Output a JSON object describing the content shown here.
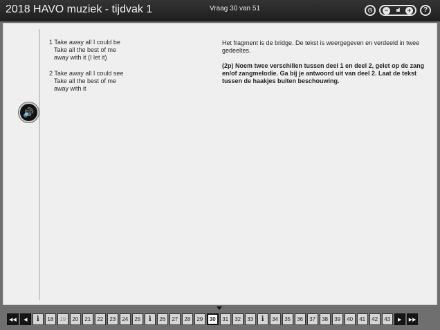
{
  "titlebar": {
    "app_title": "2018 HAVO muziek - tijdvak 1",
    "question_counter": "Vraag 30 van 51",
    "timer_icon": "clock-icon",
    "volume_label": "◂ıııll ▸",
    "help_label": "?"
  },
  "lyrics": {
    "part1": [
      "1 Take away all I could be",
      "Take all the best of me",
      "away with it (I let it)"
    ],
    "part2": [
      "2 Take away all I could see",
      "Take all the best of me",
      "away with it"
    ]
  },
  "question": {
    "intro": "Het fragment is de bridge. De tekst is weergegeven en verdeeld in twee gedeeltes.",
    "text": "(2p) Noem twee verschillen tussen deel 1 en deel 2, gelet op de zang en/of zangmelodie. Ga bij je antwoord uit van deel 2. Laat de tekst tussen de haakjes buiten beschouwing."
  },
  "navigation": {
    "buttons": [
      {
        "label": "◀◀",
        "kind": "dark",
        "name": "first-page-button"
      },
      {
        "label": "◀",
        "kind": "dark",
        "name": "prev-page-button"
      },
      {
        "label": "i",
        "kind": "info",
        "name": "info-button"
      },
      {
        "label": "18",
        "kind": "num"
      },
      {
        "label": "19",
        "kind": "visited"
      },
      {
        "label": "20",
        "kind": "num"
      },
      {
        "label": "21",
        "kind": "num"
      },
      {
        "label": "22",
        "kind": "num"
      },
      {
        "label": "23",
        "kind": "num"
      },
      {
        "label": "24",
        "kind": "num"
      },
      {
        "label": "25",
        "kind": "num"
      },
      {
        "label": "i",
        "kind": "info",
        "name": "info-button"
      },
      {
        "label": "26",
        "kind": "num"
      },
      {
        "label": "27",
        "kind": "num"
      },
      {
        "label": "28",
        "kind": "num"
      },
      {
        "label": "29",
        "kind": "num"
      },
      {
        "label": "30",
        "kind": "current"
      },
      {
        "label": "31",
        "kind": "num"
      },
      {
        "label": "32",
        "kind": "num"
      },
      {
        "label": "33",
        "kind": "num"
      },
      {
        "label": "i",
        "kind": "info",
        "name": "info-button"
      },
      {
        "label": "34",
        "kind": "num"
      },
      {
        "label": "35",
        "kind": "num"
      },
      {
        "label": "36",
        "kind": "num"
      },
      {
        "label": "37",
        "kind": "num"
      },
      {
        "label": "38",
        "kind": "num"
      },
      {
        "label": "39",
        "kind": "num"
      },
      {
        "label": "40",
        "kind": "num"
      },
      {
        "label": "41",
        "kind": "num"
      },
      {
        "label": "42",
        "kind": "num"
      },
      {
        "label": "43",
        "kind": "num"
      },
      {
        "label": "▶",
        "kind": "dark",
        "name": "next-page-button"
      },
      {
        "label": "▶▶",
        "kind": "dark",
        "name": "last-page-button"
      }
    ]
  },
  "colors": {
    "titlebar": "#2a2a2a",
    "content_bg": "#efefef",
    "page_bg": "#6f6f6f"
  }
}
